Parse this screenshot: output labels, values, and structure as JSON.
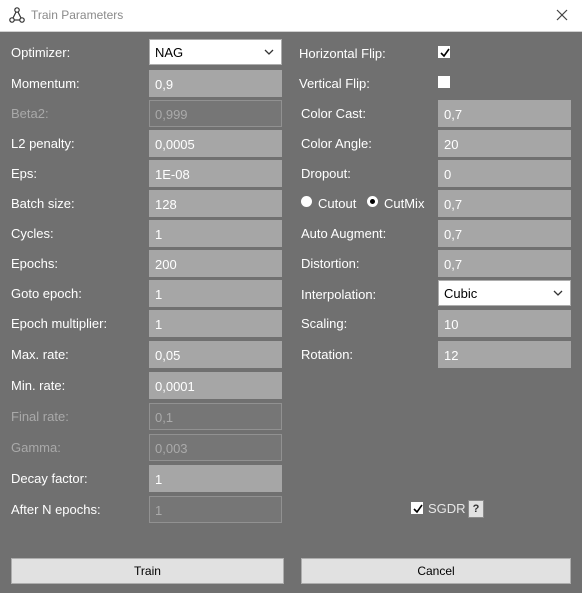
{
  "window": {
    "title": "Train Parameters"
  },
  "left": {
    "optimizer": {
      "label": "Optimizer:",
      "value": "NAG"
    },
    "momentum": {
      "label": "Momentum:",
      "value": "0,9"
    },
    "beta2": {
      "label": "Beta2:",
      "value": "0,999"
    },
    "l2": {
      "label": "L2 penalty:",
      "value": "0,0005"
    },
    "eps": {
      "label": "Eps:",
      "value": "1E-08"
    },
    "batch": {
      "label": "Batch size:",
      "value": "128"
    },
    "cycles": {
      "label": "Cycles:",
      "value": "1"
    },
    "epochs": {
      "label": "Epochs:",
      "value": "200"
    },
    "goto_epoch": {
      "label": "Goto epoch:",
      "value": "1"
    },
    "epoch_mult": {
      "label": "Epoch multiplier:",
      "value": "1"
    },
    "max_rate": {
      "label": "Max. rate:",
      "value": "0,05"
    },
    "min_rate": {
      "label": "Min. rate:",
      "value": "0,0001"
    },
    "final_rate": {
      "label": "Final rate:",
      "value": "0,1"
    },
    "gamma": {
      "label": "Gamma:",
      "value": "0,003"
    },
    "decay": {
      "label": "Decay factor:",
      "value": "1"
    },
    "after_n": {
      "label": "After N epochs:",
      "value": "1"
    }
  },
  "right": {
    "hflip": {
      "label": "Horizontal Flip:",
      "checked": true
    },
    "vflip": {
      "label": "Vertical Flip:",
      "checked": false
    },
    "color_cast": {
      "label": "Color Cast:",
      "value": "0,7"
    },
    "color_angle": {
      "label": "Color Angle:",
      "value": "20"
    },
    "dropout": {
      "label": "Dropout:",
      "value": "0"
    },
    "cutout": {
      "label": "Cutout",
      "selected": false
    },
    "cutmix": {
      "label": "CutMix",
      "selected": true,
      "value": "0,7"
    },
    "auto_augment": {
      "label": "Auto Augment:",
      "value": "0,7"
    },
    "distortion": {
      "label": "Distortion:",
      "value": "0,7"
    },
    "interpolation": {
      "label": "Interpolation:",
      "value": "Cubic"
    },
    "scaling": {
      "label": "Scaling:",
      "value": "10"
    },
    "rotation": {
      "label": "Rotation:",
      "value": "12"
    }
  },
  "sgdr": {
    "label": "SGDR",
    "checked": true,
    "help": "?"
  },
  "buttons": {
    "train": "Train",
    "cancel": "Cancel"
  }
}
